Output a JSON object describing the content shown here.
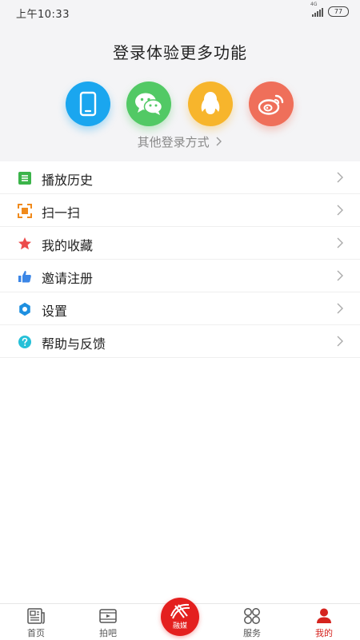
{
  "status_bar": {
    "time": "上午10:33",
    "network": "4G",
    "battery": "77"
  },
  "login": {
    "title": "登录体验更多功能",
    "other_methods": "其他登录方式",
    "methods": [
      {
        "name": "phone",
        "icon": "phone-icon",
        "color": "#1aa6ef"
      },
      {
        "name": "wechat",
        "icon": "wechat-icon",
        "color": "#52c965"
      },
      {
        "name": "qq",
        "icon": "qq-icon",
        "color": "#f7b52c"
      },
      {
        "name": "weibo",
        "icon": "weibo-icon",
        "color": "#ef6f5a"
      }
    ]
  },
  "menu": {
    "items": [
      {
        "label": "播放历史",
        "icon": "list-icon",
        "color": "#3bb44a"
      },
      {
        "label": "扫一扫",
        "icon": "scan-icon",
        "color": "#f08a1c"
      },
      {
        "label": "我的收藏",
        "icon": "star-icon",
        "color": "#ec4b4b"
      },
      {
        "label": "邀请注册",
        "icon": "thumbs-up-icon",
        "color": "#3b86e6"
      },
      {
        "label": "设置",
        "icon": "gear-icon",
        "color": "#1e8fe0"
      },
      {
        "label": "帮助与反馈",
        "icon": "help-icon",
        "color": "#25c0d8"
      }
    ]
  },
  "tab_bar": {
    "tabs": [
      {
        "label": "首页",
        "icon": "news-icon"
      },
      {
        "label": "拍吧",
        "icon": "video-icon"
      },
      {
        "label": "融媒",
        "icon": "media-logo-icon"
      },
      {
        "label": "服务",
        "icon": "grid-icon"
      },
      {
        "label": "我的",
        "icon": "person-icon"
      }
    ],
    "active_color": "#d5231e",
    "center_color": "#e4201f"
  }
}
